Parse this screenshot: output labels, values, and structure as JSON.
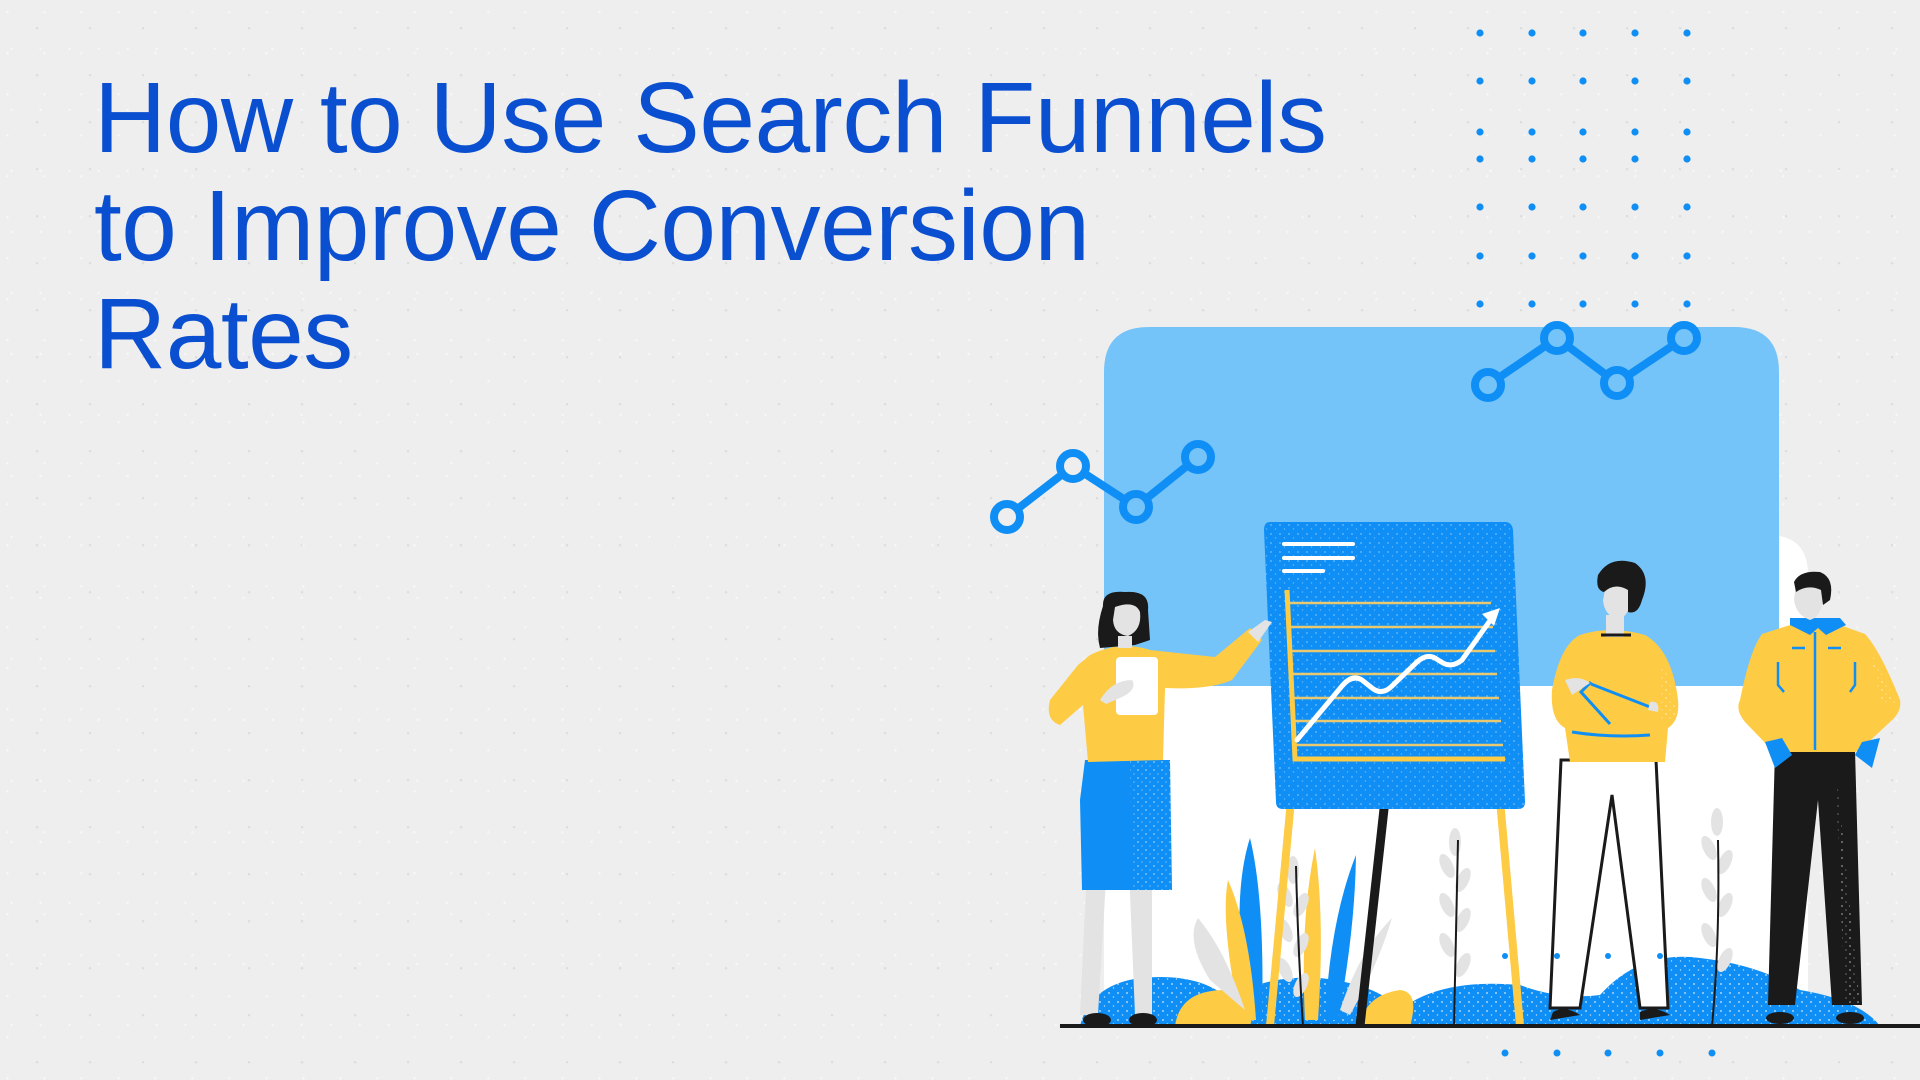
{
  "title": {
    "lines": [
      "How to Use Search Funnels",
      "to Improve Conversion",
      "Rates"
    ]
  },
  "illustration": {
    "description": "Three people presenting a rising line chart on an easel",
    "elements": [
      "dot-grid",
      "line-graph-icon",
      "line-graph-icon",
      "easel-chart",
      "presenter-woman",
      "man-arms-crossed",
      "man-hands-on-hips",
      "plants",
      "ground-line"
    ]
  },
  "colors": {
    "background": "#EEEEEE",
    "title": "#0B4FD1",
    "panel_light_blue": "#74C3F9",
    "accent_blue": "#0F8FF5",
    "yellow": "#FECB45",
    "dark": "#1A1A1A"
  }
}
